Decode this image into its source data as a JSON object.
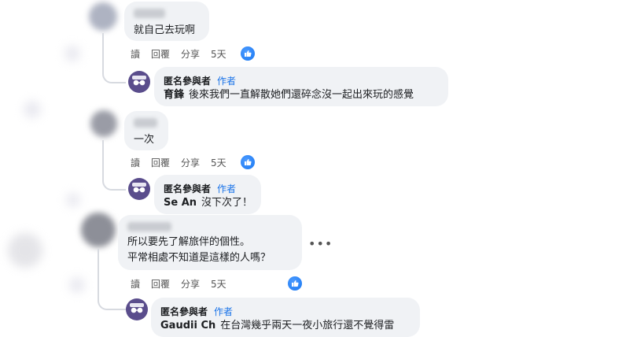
{
  "colors": {
    "like_blue": "#1877f2",
    "author_blue": "#1a73e8",
    "bubble_bg": "#f0f2f5",
    "anon_avatar": "#5a4d8c"
  },
  "actions": {
    "read": "讀",
    "reply": "回覆",
    "share": "分享"
  },
  "comments": [
    {
      "text": "就自己去玩啊",
      "time": "5天",
      "reply": {
        "name": "匿名參與者",
        "badge": "作者",
        "tag": "育鋒",
        "text": "後來我們一直解散她們還碎念沒一起出來玩的感覺"
      }
    },
    {
      "text": "一次",
      "time": "5天",
      "reply": {
        "name": "匿名參與者",
        "badge": "作者",
        "tag": "Se An",
        "text": "沒下次了！"
      }
    },
    {
      "text_lines": [
        "所以要先了解旅伴的個性。",
        "平常相處不知道是這樣的人嗎？"
      ],
      "time": "5天",
      "more": "•••",
      "reply": {
        "name": "匿名參與者",
        "badge": "作者",
        "tag": "Gaudii Ch",
        "text": "在台灣幾乎兩天一夜小旅行還不覺得雷"
      }
    }
  ],
  "icons": {
    "like": "thumbs-up-icon",
    "anon": "anonymous-avatar-icon",
    "more": "more-options-icon"
  }
}
